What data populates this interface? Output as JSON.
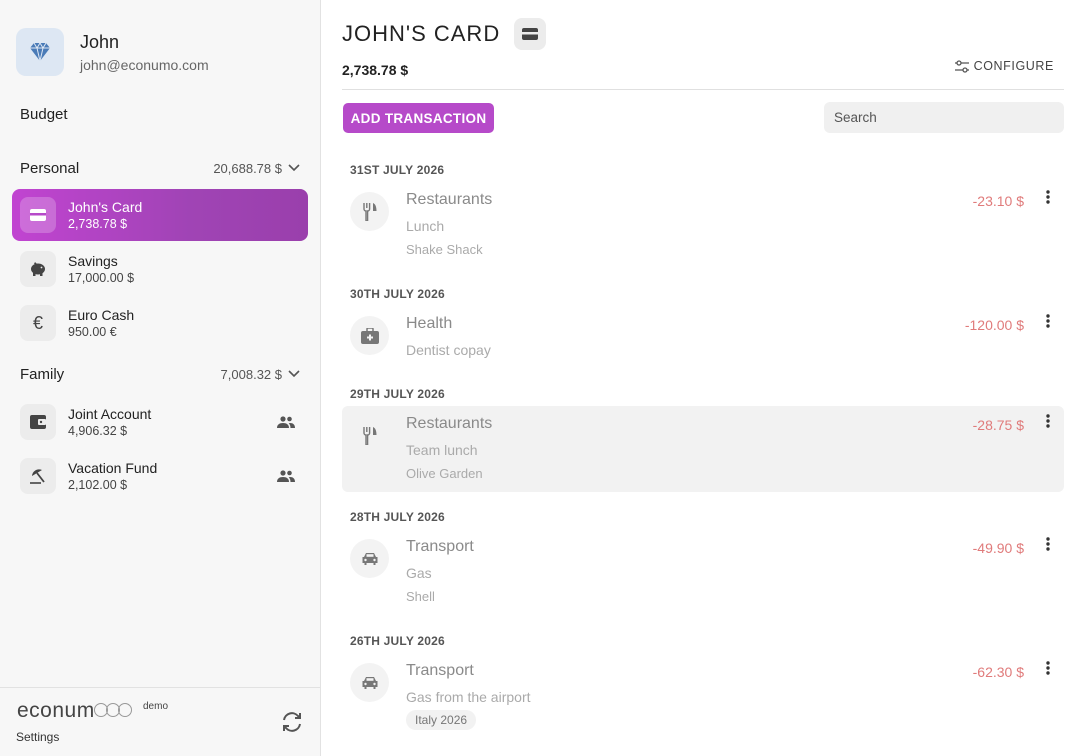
{
  "user": {
    "name": "John",
    "email": "john@econumo.com"
  },
  "sidebar": {
    "budget_label": "Budget",
    "folders": [
      {
        "name": "Personal",
        "total": "20,688.78 $",
        "accounts": [
          {
            "name": "John's Card",
            "balance": "2,738.78 $",
            "icon": "credit-card-icon",
            "active": true
          },
          {
            "name": "Savings",
            "balance": "17,000.00 $",
            "icon": "piggy-bank-icon"
          },
          {
            "name": "Euro Cash",
            "balance": "950.00 €",
            "icon": "euro-icon"
          }
        ]
      },
      {
        "name": "Family",
        "total": "7,008.32 $",
        "accounts": [
          {
            "name": "Joint Account",
            "balance": "4,906.32 $",
            "icon": "wallet-icon",
            "shared": true
          },
          {
            "name": "Vacation Fund",
            "balance": "2,102.00 $",
            "icon": "beach-umbrella-icon",
            "shared": true
          }
        ]
      }
    ],
    "footer": {
      "logo": "econum",
      "demo": "demo",
      "settings": "Settings"
    }
  },
  "main": {
    "title": "JOHN'S CARD",
    "balance": "2,738.78 $",
    "configure": "CONFIGURE",
    "add_transaction": "ADD TRANSACTION",
    "search_placeholder": "Search",
    "groups": [
      {
        "date": "31ST JULY 2026",
        "transactions": [
          {
            "category": "Restaurants",
            "icon": "fork-knife-icon",
            "description": "Lunch",
            "payee": "Shake Shack",
            "amount": "-23.10 $"
          }
        ]
      },
      {
        "date": "30TH JULY 2026",
        "transactions": [
          {
            "category": "Health",
            "icon": "medical-kit-icon",
            "description": "Dentist copay",
            "amount": "-120.00 $"
          }
        ]
      },
      {
        "date": "29TH JULY 2026",
        "transactions": [
          {
            "category": "Restaurants",
            "icon": "fork-knife-icon",
            "description": "Team lunch",
            "payee": "Olive Garden",
            "amount": "-28.75 $",
            "hover": true
          }
        ]
      },
      {
        "date": "28TH JULY 2026",
        "transactions": [
          {
            "category": "Transport",
            "icon": "car-icon",
            "description": "Gas",
            "payee": "Shell",
            "amount": "-49.90 $"
          }
        ]
      },
      {
        "date": "26TH JULY 2026",
        "transactions": [
          {
            "category": "Transport",
            "icon": "car-icon",
            "description": "Gas from the airport",
            "tag": "Italy 2026",
            "amount": "-62.30 $"
          }
        ]
      }
    ]
  },
  "colors": {
    "accent": "#b64ac9",
    "negative_amount": "#e07b7b"
  }
}
